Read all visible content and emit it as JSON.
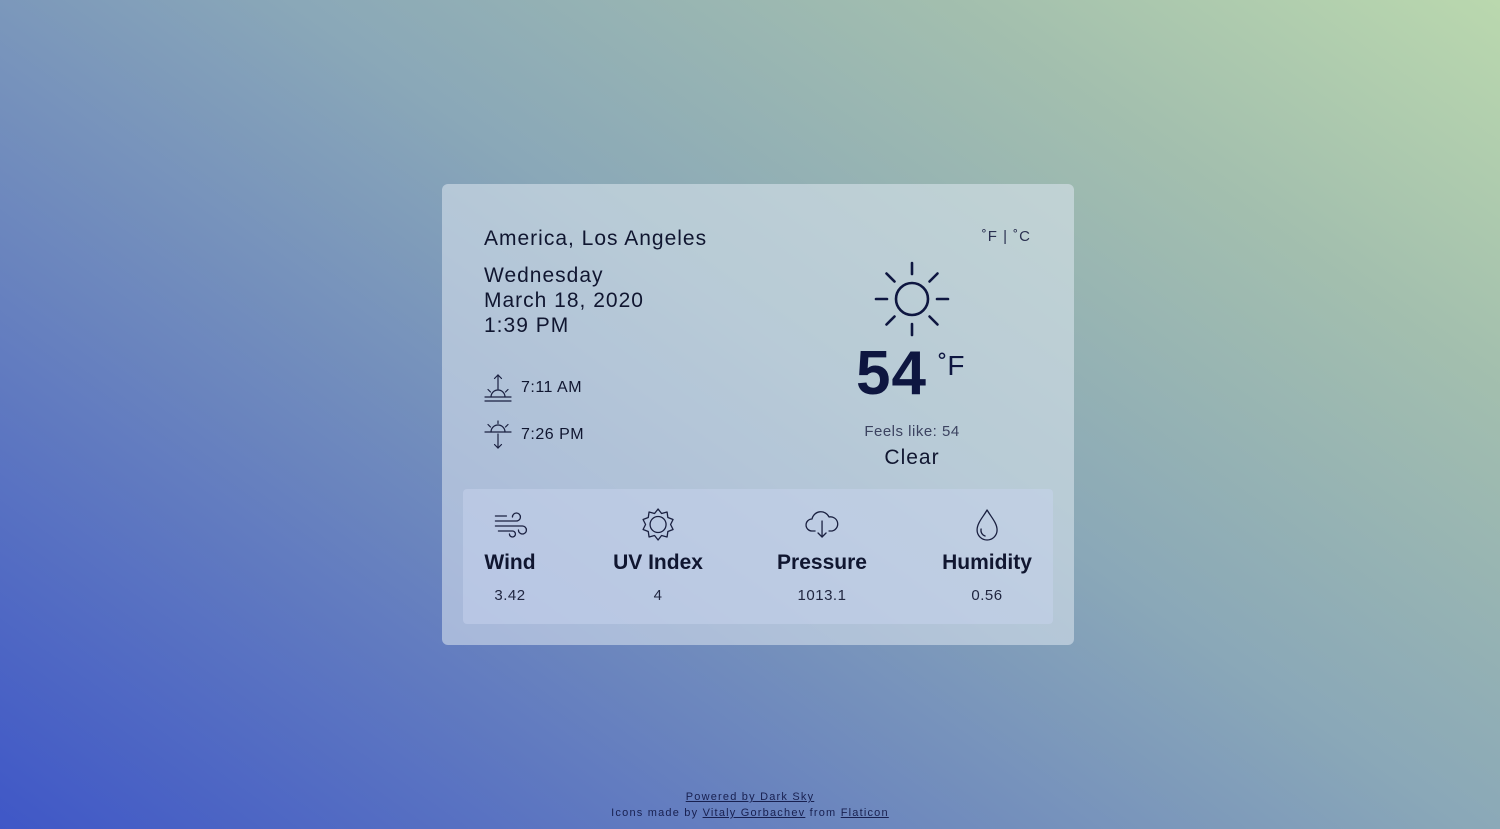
{
  "location": "America, Los Angeles",
  "date": {
    "weekday": "Wednesday",
    "full_date": "March 18, 2020",
    "time": "1:39 PM"
  },
  "sun": {
    "sunrise": "7:11 AM",
    "sunset": "7:26 PM",
    "sunrise_icon": "sunrise-icon",
    "sunset_icon": "sunset-icon"
  },
  "units": {
    "fahrenheit": "˚F",
    "separator": "|",
    "celsius": "˚C"
  },
  "current": {
    "icon": "sun-icon",
    "temperature": "54",
    "unit": "˚F",
    "feels_like": "Feels like: 54",
    "condition": "Clear"
  },
  "stats": [
    {
      "icon": "wind-icon",
      "label": "Wind",
      "value": "3.42"
    },
    {
      "icon": "uv-icon",
      "label": "UV Index",
      "value": "4"
    },
    {
      "icon": "pressure-icon",
      "label": "Pressure",
      "value": "1013.1"
    },
    {
      "icon": "humidity-icon",
      "label": "Humidity",
      "value": "0.56"
    }
  ],
  "footer": {
    "powered_by": "Powered by Dark Sky",
    "icons_prefix": "Icons made by",
    "author": "Vitaly Gorbachev",
    "from_text": "from",
    "source": "Flaticon"
  },
  "colors": {
    "text_dark": "#101630",
    "gradient_start": "#3f57c7",
    "gradient_end": "#bad8ae"
  }
}
